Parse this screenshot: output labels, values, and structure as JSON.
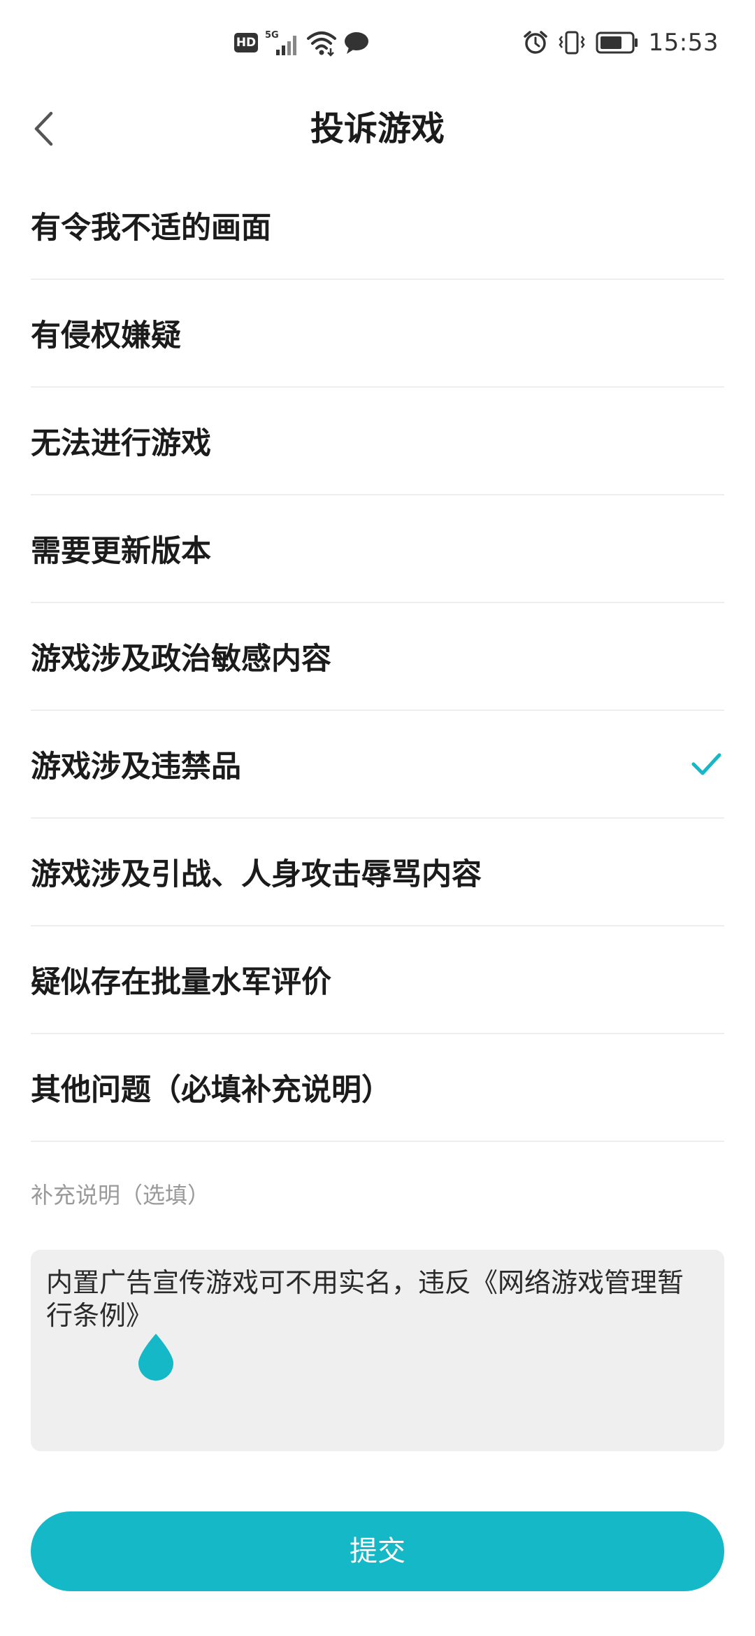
{
  "status_bar": {
    "hd": "HD",
    "network": "5G",
    "time": "15:53"
  },
  "header": {
    "title": "投诉游戏",
    "back_icon": "chevron-left-icon"
  },
  "reasons": [
    {
      "label": "有令我不适的画面",
      "selected": false
    },
    {
      "label": "有侵权嫌疑",
      "selected": false
    },
    {
      "label": "无法进行游戏",
      "selected": false
    },
    {
      "label": "需要更新版本",
      "selected": false
    },
    {
      "label": "游戏涉及政治敏感内容",
      "selected": false
    },
    {
      "label": "游戏涉及违禁品",
      "selected": true
    },
    {
      "label": "游戏涉及引战、人身攻击辱骂内容",
      "selected": false
    },
    {
      "label": "疑似存在批量水军评价",
      "selected": false
    },
    {
      "label": "其他问题（必填补充说明）",
      "selected": false
    }
  ],
  "supplement": {
    "label": "补充说明（选填）",
    "value": "内置广告宣传游戏可不用实名，违反《网络游戏管理暂行条例》"
  },
  "submit": {
    "label": "提交"
  },
  "colors": {
    "accent": "#14b8c6",
    "text": "#1b1b1b",
    "divider": "#eeeeee",
    "hint": "#9a9a9a",
    "input_bg": "#efefef"
  }
}
